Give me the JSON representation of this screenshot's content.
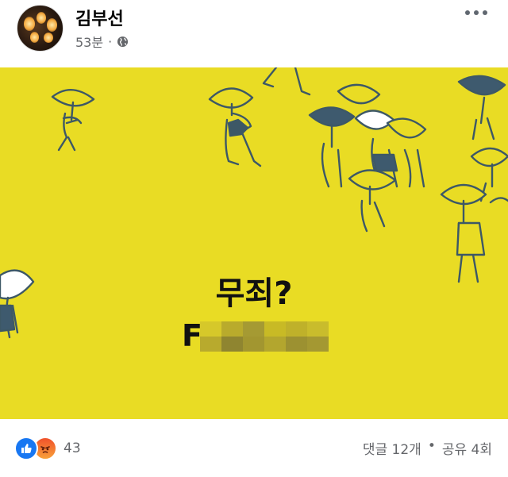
{
  "post": {
    "author": "김부선",
    "time": "53분",
    "separator": "·",
    "privacy_icon": "globe-icon",
    "more_icon": "more-options-icon"
  },
  "image": {
    "headline": "무죄?",
    "subline_visible": "F",
    "background_color": "#e9dc24",
    "illustration": "people-with-umbrellas"
  },
  "footer": {
    "reaction_icons": [
      "like-icon",
      "angry-icon"
    ],
    "reaction_count": "43",
    "comments": "댓글 12개",
    "stat_separator": "•",
    "shares": "공유 4회"
  },
  "colors": {
    "accent": "#1877f2",
    "muted_text": "#65676b",
    "illustration_line": "#3d5866",
    "umbrella_dark": "#3e5a6e"
  }
}
